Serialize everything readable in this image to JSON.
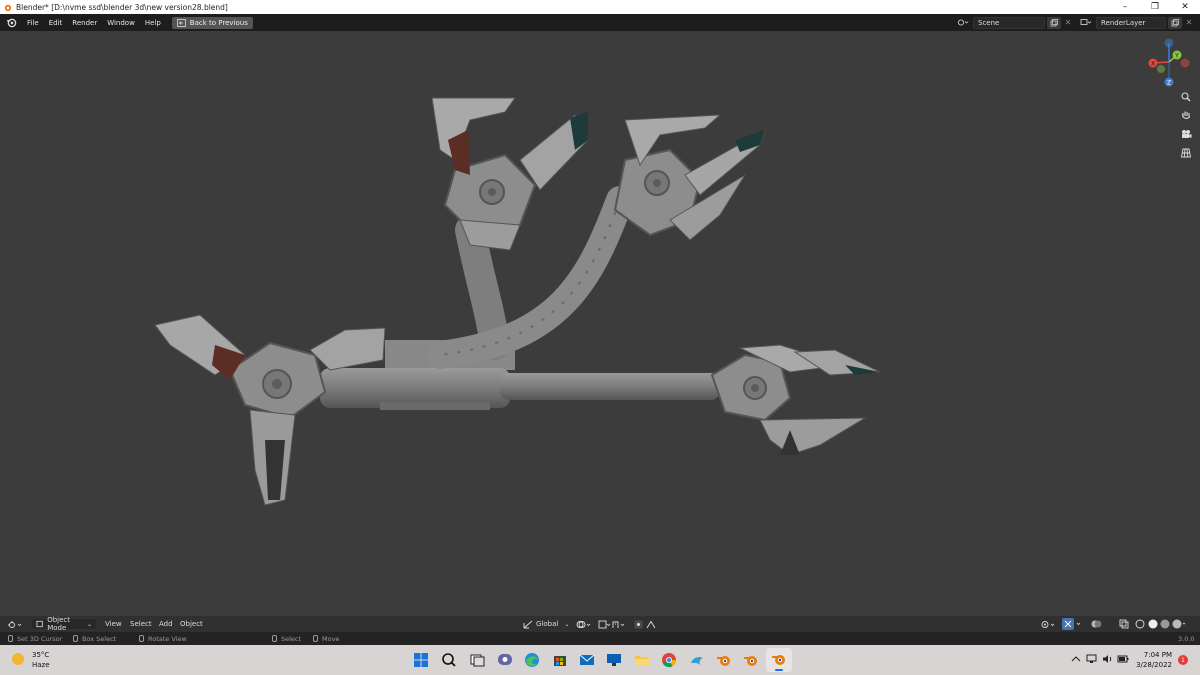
{
  "window": {
    "title": "Blender* [D:\\nvme ssd\\blender 3d\\new version28.blend]",
    "minimize": "–",
    "maximize": "❐",
    "close": "✕"
  },
  "topbar": {
    "menus": [
      "File",
      "Edit",
      "Render",
      "Window",
      "Help"
    ],
    "back_button": "Back to Previous",
    "scene": "Scene",
    "render_layer": "RenderLayer"
  },
  "viewport_header": {
    "mode": "Object Mode",
    "menus": [
      "View",
      "Select",
      "Add",
      "Object"
    ],
    "orientation": "Global"
  },
  "gizmo": {
    "z_label": "Z",
    "y_label": "Y",
    "x_label": "X",
    "colors": {
      "x": "#e2473f",
      "y": "#8cc63e",
      "z": "#3a7fd4"
    }
  },
  "statusbar": {
    "items": [
      "Set 3D Cursor",
      "Box Select",
      "Rotate View",
      "Select",
      "Move"
    ],
    "version": "3.0.0"
  },
  "taskbar": {
    "weather_temp": "35°C",
    "weather_desc": "Haze",
    "time": "7:04 PM",
    "date": "3/28/2022",
    "notification_count": "1"
  }
}
